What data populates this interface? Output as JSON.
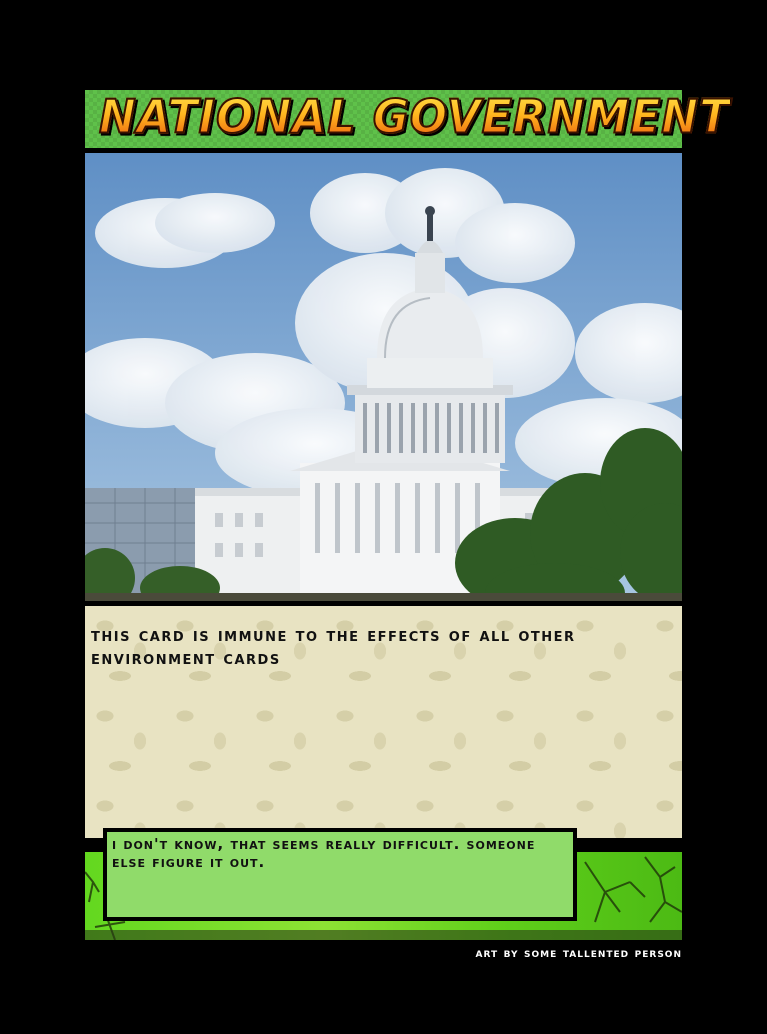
{
  "card": {
    "title": "National Government",
    "rules_text": "This card is immune to the effects of all other environment cards",
    "flavor_text": "I don't know, that seems really difficult. Someone else figure it out.",
    "credit": "Art by some tallented person",
    "artwork": "capitol-building-photo"
  },
  "colors": {
    "title_bar": "#5fc14a",
    "text_box": "#e8e3c2",
    "flavor_box": "#90db6a",
    "background": "#000000"
  }
}
